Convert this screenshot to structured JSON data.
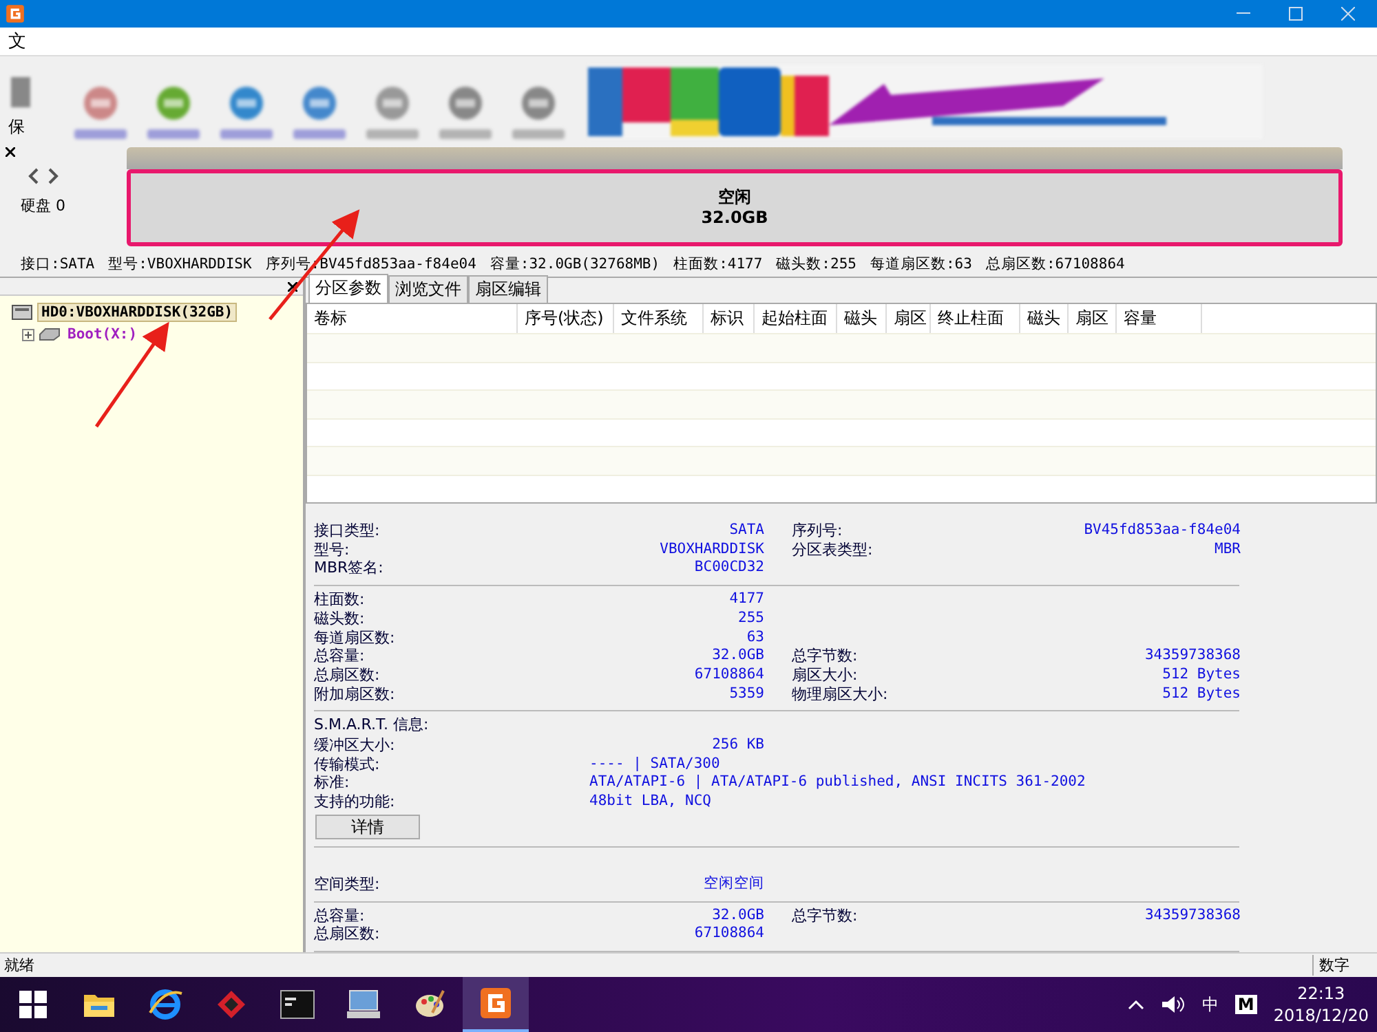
{
  "menu_bar": {
    "items": [
      "文"
    ]
  },
  "toolbar": {
    "partial_label": "保"
  },
  "disk_map": {
    "disk_label": "硬盘 0",
    "free_space": {
      "label": "空闲",
      "size": "32.0GB",
      "selected": true
    }
  },
  "disk_info": [
    "接口:SATA",
    "型号:VBOXHARDDISK",
    "序列号:BV45fd853aa-f84e04",
    "容量:32.0GB(32768MB)",
    "柱面数:4177",
    "磁头数:255",
    "每道扇区数:63",
    "总扇区数:67108864"
  ],
  "tree": [
    {
      "label": "HD0:VBOXHARDDISK(32GB)",
      "kind": "disk",
      "selected": true,
      "children": [
        {
          "label": "Boot(X:)",
          "kind": "partition",
          "selected": false,
          "expanded": false
        }
      ]
    }
  ],
  "tabs": [
    {
      "label": "分区参数",
      "selected": true
    },
    {
      "label": "浏览文件",
      "selected": false
    },
    {
      "label": "扇区编辑",
      "selected": false
    }
  ],
  "table": {
    "columns": [
      "卷标",
      "序号(状态)",
      "文件系统",
      "标识",
      "起始柱面",
      "磁头",
      "扇区",
      "终止柱面",
      "磁头",
      "扇区",
      "容量"
    ]
  },
  "details": {
    "sections": [
      {
        "rows": [
          {
            "kind": "pair",
            "label": "接口类型:",
            "value": "SATA",
            "label2": "序列号:",
            "value2": "BV45fd853aa-f84e04"
          },
          {
            "kind": "pair",
            "label": "型号:",
            "value": "VBOXHARDDISK",
            "label2": "分区表类型:",
            "value2": "MBR"
          },
          {
            "kind": "pair",
            "label": "MBR签名:",
            "value": "BC00CD32"
          }
        ]
      },
      {
        "rows": [
          {
            "kind": "pair",
            "label": "柱面数:",
            "value": "4177"
          },
          {
            "kind": "pair",
            "label": "磁头数:",
            "value": "255"
          },
          {
            "kind": "pair",
            "label": "每道扇区数:",
            "value": "63"
          },
          {
            "kind": "pair",
            "label": "总容量:",
            "value": "32.0GB",
            "label2": "总字节数:",
            "value2": "34359738368"
          },
          {
            "kind": "pair",
            "label": "总扇区数:",
            "value": "67108864",
            "label2": "扇区大小:",
            "value2": "512 Bytes"
          },
          {
            "kind": "pair",
            "label": "附加扇区数:",
            "value": "5359",
            "label2": "物理扇区大小:",
            "value2": "512 Bytes"
          }
        ]
      },
      {
        "rows": [
          {
            "kind": "heading",
            "label": "S.M.A.R.T. 信息:"
          },
          {
            "kind": "pair",
            "label": "缓冲区大小:",
            "value": "256 KB"
          },
          {
            "kind": "wide",
            "label": "传输模式:",
            "value": "---- | SATA/300"
          },
          {
            "kind": "wide",
            "label": "标准:",
            "value": "ATA/ATAPI-6 | ATA/ATAPI-6 published, ANSI INCITS 361-2002"
          },
          {
            "kind": "wide",
            "label": "支持的功能:",
            "value": "48bit LBA, NCQ"
          },
          {
            "kind": "button",
            "label": "详情"
          }
        ]
      },
      {
        "rows": [
          {
            "kind": "pair",
            "label": "空间类型:",
            "value": "空闲空间"
          }
        ]
      },
      {
        "rows": [
          {
            "kind": "pair",
            "label": "总容量:",
            "value": "32.0GB",
            "label2": "总字节数:",
            "value2": "34359738368"
          },
          {
            "kind": "pair",
            "label": "总扇区数:",
            "value": "67108864"
          }
        ]
      }
    ]
  },
  "status_bar": {
    "left": "就绪",
    "right": "数字"
  },
  "taskbar": {
    "apps": [
      {
        "kind": "folder",
        "selected": false
      },
      {
        "kind": "browser",
        "selected": false
      },
      {
        "kind": "diamond",
        "selected": false
      },
      {
        "kind": "terminal",
        "selected": false
      },
      {
        "kind": "network",
        "selected": false
      },
      {
        "kind": "palette",
        "selected": false
      },
      {
        "kind": "diskgenius",
        "selected": true
      }
    ],
    "ime": "中",
    "input_mode": "M",
    "time": "22:13",
    "date": "2018/12/20"
  }
}
